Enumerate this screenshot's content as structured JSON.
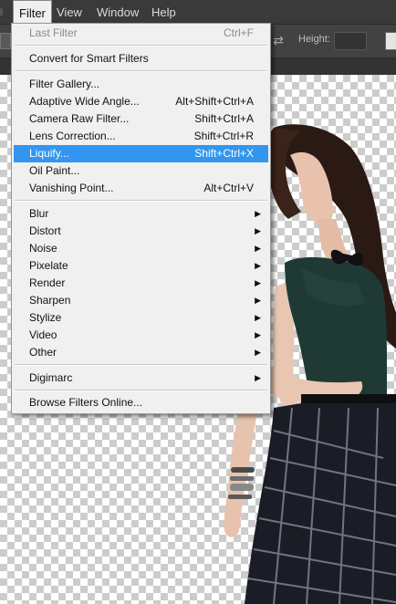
{
  "menubar": {
    "items": [
      {
        "label": "Filter"
      },
      {
        "label": "View"
      },
      {
        "label": "Window"
      },
      {
        "label": "Help"
      }
    ]
  },
  "options_bar": {
    "height_label": "Height:",
    "swap_icon": "swap-arrows-icon"
  },
  "filter_menu": {
    "last_filter": {
      "label": "Last Filter",
      "shortcut": "Ctrl+F"
    },
    "convert_smart": {
      "label": "Convert for Smart Filters"
    },
    "gallery": {
      "label": "Filter Gallery..."
    },
    "adaptive": {
      "label": "Adaptive Wide Angle...",
      "shortcut": "Alt+Shift+Ctrl+A"
    },
    "camera_raw": {
      "label": "Camera Raw Filter...",
      "shortcut": "Shift+Ctrl+A"
    },
    "lens": {
      "label": "Lens Correction...",
      "shortcut": "Shift+Ctrl+R"
    },
    "liquify": {
      "label": "Liquify...",
      "shortcut": "Shift+Ctrl+X"
    },
    "oil_paint": {
      "label": "Oil Paint..."
    },
    "vanishing": {
      "label": "Vanishing Point...",
      "shortcut": "Alt+Ctrl+V"
    },
    "submenus": [
      {
        "label": "Blur"
      },
      {
        "label": "Distort"
      },
      {
        "label": "Noise"
      },
      {
        "label": "Pixelate"
      },
      {
        "label": "Render"
      },
      {
        "label": "Sharpen"
      },
      {
        "label": "Stylize"
      },
      {
        "label": "Video"
      },
      {
        "label": "Other"
      }
    ],
    "digimarc": {
      "label": "Digimarc"
    },
    "browse": {
      "label": "Browse Filters Online..."
    },
    "highlight_color": "#3296f0",
    "submenu_arrow": "▶"
  }
}
